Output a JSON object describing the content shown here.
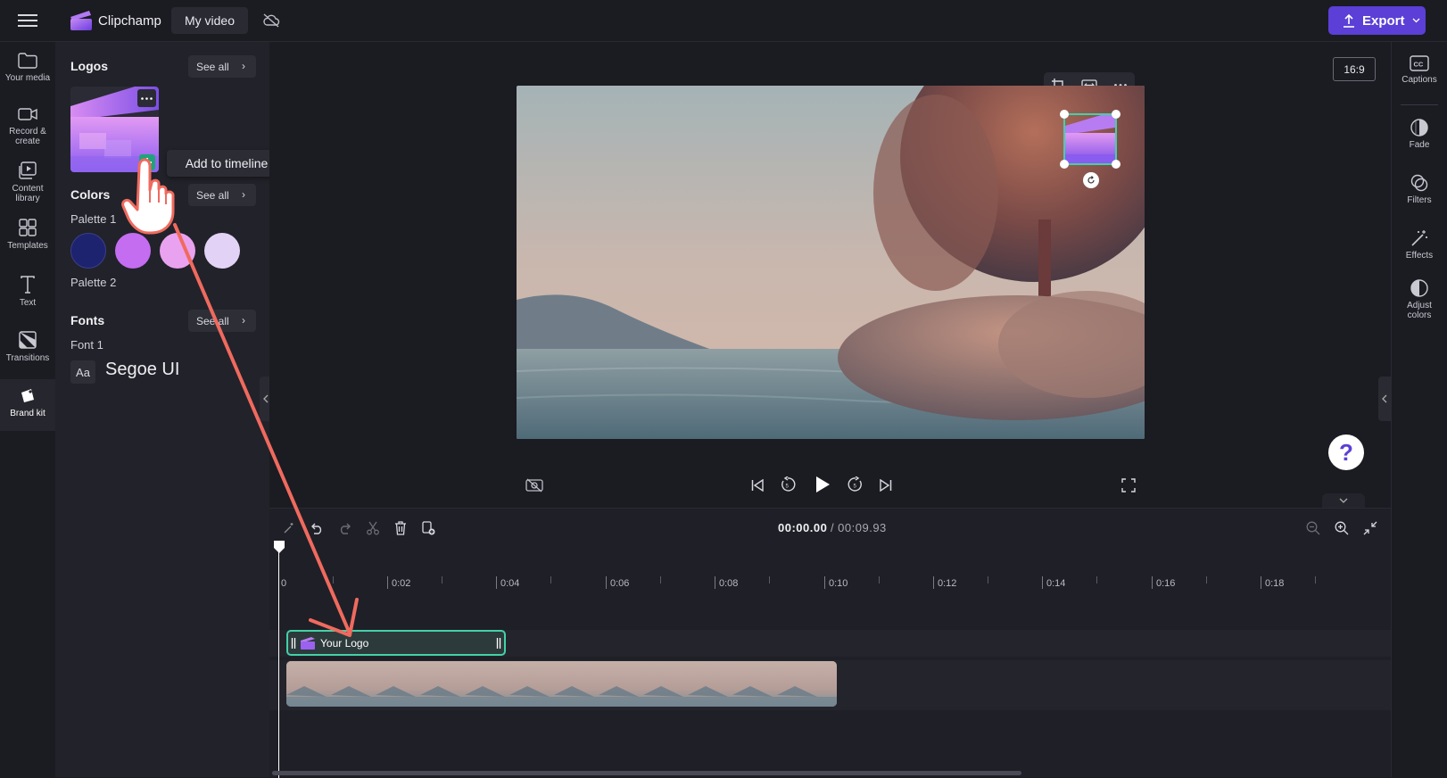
{
  "app": {
    "name": "Clipchamp",
    "project_title": "My video",
    "export_label": "Export",
    "accent": "#5b3fd6"
  },
  "left_rail": {
    "items": [
      {
        "label": "Your media",
        "icon": "folder-icon"
      },
      {
        "label": "Record & create",
        "icon": "camera-icon"
      },
      {
        "label": "Content library",
        "icon": "content-library-icon"
      },
      {
        "label": "Templates",
        "icon": "templates-icon"
      },
      {
        "label": "Text",
        "icon": "text-icon"
      },
      {
        "label": "Transitions",
        "icon": "transitions-icon"
      },
      {
        "label": "Brand kit",
        "icon": "brand-kit-icon",
        "active": true
      }
    ]
  },
  "panel": {
    "logos": {
      "title": "Logos",
      "see_all": "See all"
    },
    "tooltip": "Add to timeline",
    "colors": {
      "title": "Colors",
      "see_all": "See all",
      "palette1": "Palette 1",
      "palette2": "Palette 2",
      "swatches": [
        "#1e2370",
        "#c46df0",
        "#e9a2ef",
        "#e2d3f6"
      ]
    },
    "fonts": {
      "title": "Fonts",
      "see_all": "See all",
      "font1": "Font 1",
      "font_sample": "Aa",
      "font_name": "Segoe UI"
    }
  },
  "stage": {
    "aspect_ratio": "16:9"
  },
  "right_rail": {
    "items": [
      {
        "label": "Captions",
        "icon": "captions-icon"
      },
      {
        "label": "Fade",
        "icon": "fade-icon"
      },
      {
        "label": "Filters",
        "icon": "filters-icon"
      },
      {
        "label": "Effects",
        "icon": "effects-icon"
      },
      {
        "label": "Adjust colors",
        "icon": "adjust-colors-icon"
      }
    ]
  },
  "help_label": "?",
  "timeline": {
    "current_time": "00:00.00",
    "total_time": "/ 00:09.93",
    "ticks": [
      "0",
      "0:02",
      "0:04",
      "0:06",
      "0:08",
      "0:10",
      "0:12",
      "0:14",
      "0:16",
      "0:18"
    ],
    "logo_clip_label": "Your Logo"
  }
}
